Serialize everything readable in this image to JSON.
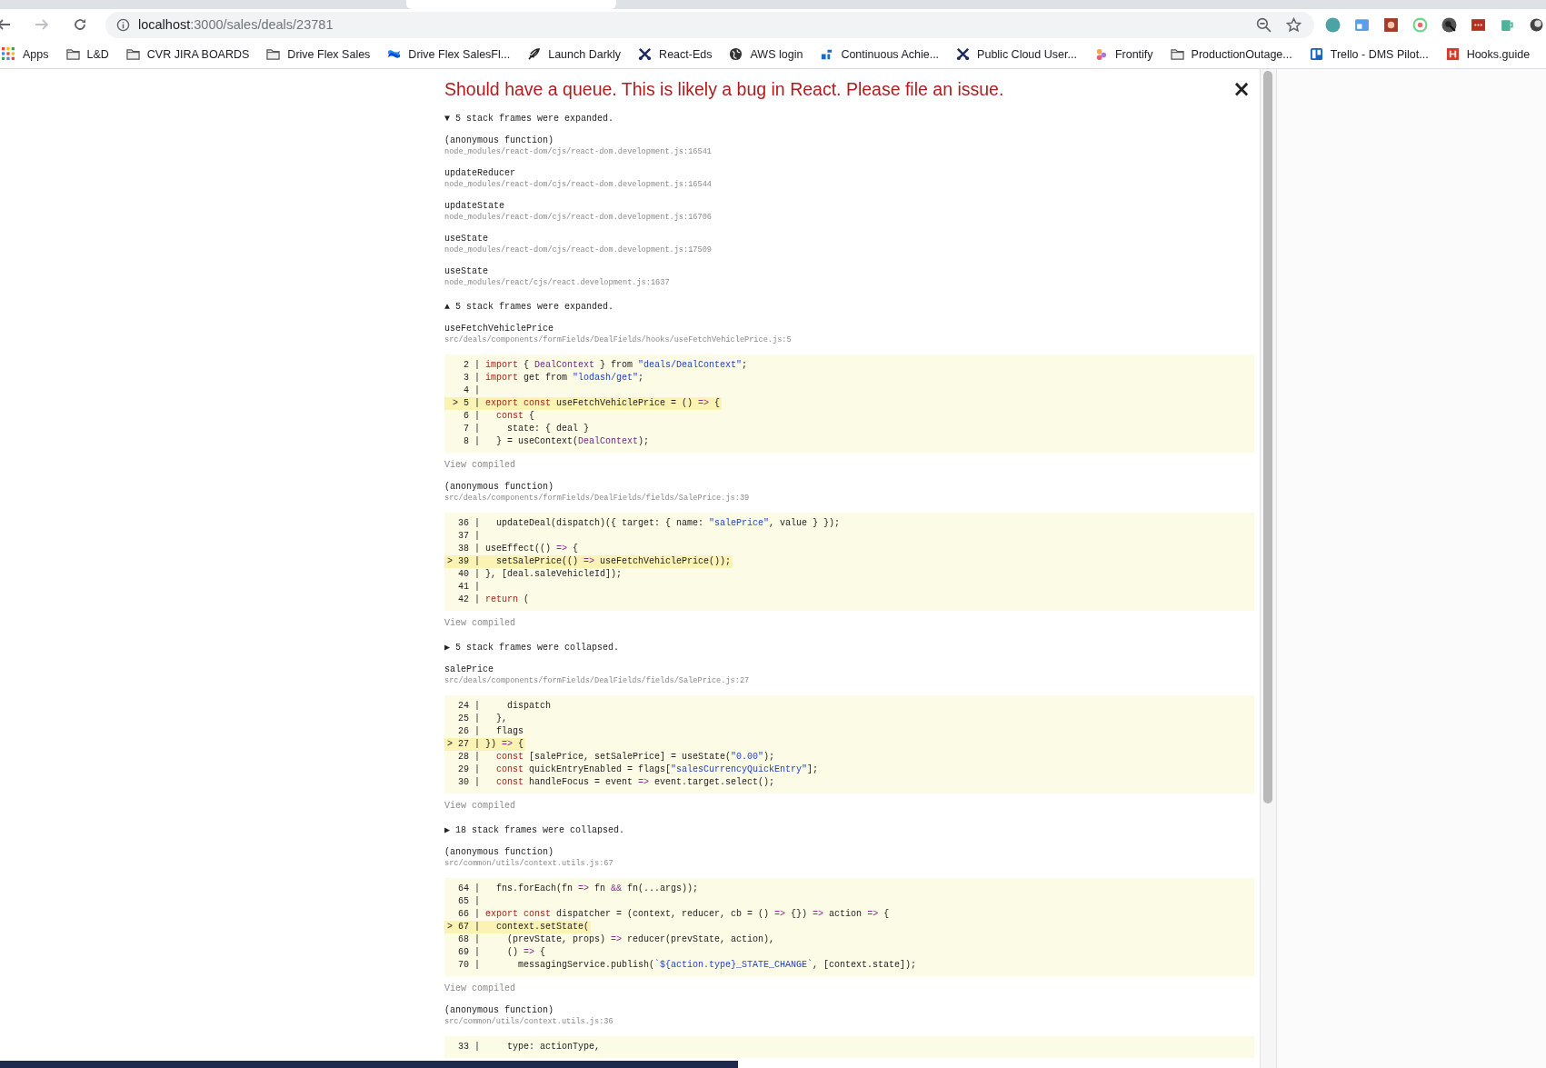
{
  "browser": {
    "url_host": "localhost",
    "url_path": ":3000/sales/deals/23781"
  },
  "bookmarks": [
    {
      "label": "Apps",
      "kind": "apps"
    },
    {
      "label": "L&D",
      "kind": "folder"
    },
    {
      "label": "CVR JIRA BOARDS",
      "kind": "folder"
    },
    {
      "label": "Drive Flex Sales",
      "kind": "folder"
    },
    {
      "label": "Drive Flex SalesFl...",
      "kind": "ribbon"
    },
    {
      "label": "Launch Darkly",
      "kind": "feather"
    },
    {
      "label": "React-Eds",
      "kind": "cross"
    },
    {
      "label": "AWS login",
      "kind": "globe"
    },
    {
      "label": "Continuous Achie...",
      "kind": "logo"
    },
    {
      "label": "Public Cloud User...",
      "kind": "cross"
    },
    {
      "label": "Frontify",
      "kind": "dots"
    },
    {
      "label": "ProductionOutage...",
      "kind": "folder"
    },
    {
      "label": "Trello - DMS Pilot...",
      "kind": "board"
    },
    {
      "label": "Hooks.guide",
      "kind": "square"
    }
  ],
  "error": {
    "title": "Should have a queue. This is likely a bug in React. Please file an issue.",
    "close": "×",
    "sections": [
      {
        "kind": "toggle",
        "text": "▼ 5 stack frames were expanded."
      },
      {
        "kind": "frame",
        "function": "(anonymous function)",
        "location": "node_modules/react-dom/cjs/react-dom.development.js:16541"
      },
      {
        "kind": "frame",
        "function": "updateReducer",
        "location": "node_modules/react-dom/cjs/react-dom.development.js:16544"
      },
      {
        "kind": "frame",
        "function": "updateState",
        "location": "node_modules/react-dom/cjs/react-dom.development.js:16706"
      },
      {
        "kind": "frame",
        "function": "useState",
        "location": "node_modules/react-dom/cjs/react-dom.development.js:17509"
      },
      {
        "kind": "frame",
        "function": "useState",
        "location": "node_modules/react/cjs/react.development.js:1637"
      },
      {
        "kind": "toggle",
        "text": "▲ 5 stack frames were expanded."
      },
      {
        "kind": "frame",
        "function": "useFetchVehiclePrice",
        "location": "src/deals/components/formFields/DealFields/hooks/useFetchVehiclePrice.js:5",
        "link": "View compiled",
        "code": [
          {
            "gutter": "2 |",
            "highlighted": false,
            "segments": [
              {
                "text": "import",
                "kind": "keyword"
              },
              {
                "text": " { ",
                "kind": "plain"
              },
              {
                "text": "DealContext",
                "kind": "name"
              },
              {
                "text": " } from ",
                "kind": "plain"
              },
              {
                "text": "\"deals/DealContext\"",
                "kind": "string"
              },
              {
                "text": ";",
                "kind": "plain"
              }
            ]
          },
          {
            "gutter": "3 |",
            "highlighted": false,
            "segments": [
              {
                "text": "import",
                "kind": "keyword"
              },
              {
                "text": " get from ",
                "kind": "plain"
              },
              {
                "text": "\"lodash/get\"",
                "kind": "string"
              },
              {
                "text": ";",
                "kind": "plain"
              }
            ]
          },
          {
            "gutter": "4 |",
            "highlighted": false
          },
          {
            "gutter": "> 5 |",
            "highlighted": true,
            "segments": [
              {
                "text": "export const",
                "kind": "keyword"
              },
              {
                "text": " useFetchVehiclePrice = () ",
                "kind": "plain"
              },
              {
                "text": "=>",
                "kind": "operator"
              },
              {
                "text": " {",
                "kind": "plain"
              }
            ]
          },
          {
            "gutter": "6 |",
            "highlighted": false,
            "segments": [
              {
                "text": "  const",
                "kind": "keyword"
              },
              {
                "text": " {",
                "kind": "plain"
              }
            ]
          },
          {
            "gutter": "7 |",
            "highlighted": false,
            "segments": [
              {
                "text": "    state: { deal }",
                "kind": "plain"
              }
            ]
          },
          {
            "gutter": "8 |",
            "highlighted": false,
            "segments": [
              {
                "text": "  } = useContext(",
                "kind": "plain"
              },
              {
                "text": "DealContext",
                "kind": "name"
              },
              {
                "text": ");",
                "kind": "plain"
              }
            ]
          }
        ]
      },
      {
        "kind": "frame",
        "function": "(anonymous function)",
        "location": "src/deals/components/formFields/DealFields/fields/SalePrice.js:39",
        "link": "View compiled",
        "code": [
          {
            "gutter": "36 |",
            "highlighted": false,
            "segments": [
              {
                "text": "  updateDeal(dispatch)({ target: { name: ",
                "kind": "plain"
              },
              {
                "text": "\"salePrice\"",
                "kind": "string"
              },
              {
                "text": ", value } });",
                "kind": "plain"
              }
            ]
          },
          {
            "gutter": "37 |",
            "highlighted": false
          },
          {
            "gutter": "38 |",
            "highlighted": false,
            "segments": [
              {
                "text": "useEffect(() ",
                "kind": "plain"
              },
              {
                "text": "=>",
                "kind": "operator"
              },
              {
                "text": " {",
                "kind": "plain"
              }
            ]
          },
          {
            "gutter": "> 39 |",
            "highlighted": true,
            "segments": [
              {
                "text": "  setSalePrice(() ",
                "kind": "plain"
              },
              {
                "text": "=>",
                "kind": "operator"
              },
              {
                "text": " useFetchVehiclePrice());",
                "kind": "plain"
              }
            ]
          },
          {
            "gutter": "40 |",
            "highlighted": false,
            "segments": [
              {
                "text": "}, [deal.saleVehicleId]);",
                "kind": "plain"
              }
            ]
          },
          {
            "gutter": "41 |",
            "highlighted": false
          },
          {
            "gutter": "42 |",
            "highlighted": false,
            "segments": [
              {
                "text": "return",
                "kind": "keyword"
              },
              {
                "text": " (",
                "kind": "plain"
              }
            ]
          }
        ]
      },
      {
        "kind": "toggle",
        "text": "▶ 5 stack frames were collapsed."
      },
      {
        "kind": "frame",
        "function": "salePrice",
        "location": "src/deals/components/formFields/DealFields/fields/SalePrice.js:27",
        "link": "View compiled",
        "code": [
          {
            "gutter": "24 |",
            "highlighted": false,
            "segments": [
              {
                "text": "    dispatch",
                "kind": "plain"
              }
            ]
          },
          {
            "gutter": "25 |",
            "highlighted": false,
            "segments": [
              {
                "text": "  },",
                "kind": "plain"
              }
            ]
          },
          {
            "gutter": "26 |",
            "highlighted": false,
            "segments": [
              {
                "text": "  flags",
                "kind": "plain"
              }
            ]
          },
          {
            "gutter": "> 27 |",
            "highlighted": true,
            "segments": [
              {
                "text": "}) ",
                "kind": "plain"
              },
              {
                "text": "=>",
                "kind": "operator"
              },
              {
                "text": " {",
                "kind": "plain"
              }
            ]
          },
          {
            "gutter": "28 |",
            "highlighted": false,
            "segments": [
              {
                "text": "  const",
                "kind": "keyword"
              },
              {
                "text": " [salePrice, setSalePrice] = useState(",
                "kind": "plain"
              },
              {
                "text": "\"0.00\"",
                "kind": "string"
              },
              {
                "text": ");",
                "kind": "plain"
              }
            ]
          },
          {
            "gutter": "29 |",
            "highlighted": false,
            "segments": [
              {
                "text": "  const",
                "kind": "keyword"
              },
              {
                "text": " quickEntryEnabled = flags[",
                "kind": "plain"
              },
              {
                "text": "\"salesCurrencyQuickEntry\"",
                "kind": "string"
              },
              {
                "text": "];",
                "kind": "plain"
              }
            ]
          },
          {
            "gutter": "30 |",
            "highlighted": false,
            "segments": [
              {
                "text": "  const",
                "kind": "keyword"
              },
              {
                "text": " handleFocus = event ",
                "kind": "plain"
              },
              {
                "text": "=>",
                "kind": "operator"
              },
              {
                "text": " event.target.select();",
                "kind": "plain"
              }
            ]
          }
        ]
      },
      {
        "kind": "toggle",
        "text": "▶ 18 stack frames were collapsed."
      },
      {
        "kind": "frame",
        "function": "(anonymous function)",
        "location": "src/common/utils/context.utils.js:67",
        "link": "View compiled",
        "code": [
          {
            "gutter": "64 |",
            "highlighted": false,
            "segments": [
              {
                "text": "  fns.forEach(fn ",
                "kind": "plain"
              },
              {
                "text": "=>",
                "kind": "operator"
              },
              {
                "text": " fn ",
                "kind": "plain"
              },
              {
                "text": "&&",
                "kind": "operator"
              },
              {
                "text": " fn(...args));",
                "kind": "plain"
              }
            ]
          },
          {
            "gutter": "65 |",
            "highlighted": false
          },
          {
            "gutter": "66 |",
            "highlighted": false,
            "segments": [
              {
                "text": "export const",
                "kind": "keyword"
              },
              {
                "text": " dispatcher = (context, reducer, cb = () ",
                "kind": "plain"
              },
              {
                "text": "=>",
                "kind": "operator"
              },
              {
                "text": " {}) ",
                "kind": "plain"
              },
              {
                "text": "=>",
                "kind": "operator"
              },
              {
                "text": " action ",
                "kind": "plain"
              },
              {
                "text": "=>",
                "kind": "operator"
              },
              {
                "text": " {",
                "kind": "plain"
              }
            ]
          },
          {
            "gutter": "> 67 |",
            "highlighted": true,
            "segments": [
              {
                "text": "  context.setState(",
                "kind": "plain"
              }
            ]
          },
          {
            "gutter": "68 |",
            "highlighted": false,
            "segments": [
              {
                "text": "    (prevState, props) ",
                "kind": "plain"
              },
              {
                "text": "=>",
                "kind": "operator"
              },
              {
                "text": " reducer(prevState, action),",
                "kind": "plain"
              }
            ]
          },
          {
            "gutter": "69 |",
            "highlighted": false,
            "segments": [
              {
                "text": "    () ",
                "kind": "plain"
              },
              {
                "text": "=>",
                "kind": "operator"
              },
              {
                "text": " {",
                "kind": "plain"
              }
            ]
          },
          {
            "gutter": "70 |",
            "highlighted": false,
            "segments": [
              {
                "text": "      messagingService.publish(",
                "kind": "plain"
              },
              {
                "text": "`${action.type}_STATE_CHANGE`",
                "kind": "string"
              },
              {
                "text": ", [context.state]);",
                "kind": "plain"
              }
            ]
          }
        ]
      },
      {
        "kind": "frame",
        "function": "(anonymous function)",
        "location": "src/common/utils/context.utils.js:36",
        "code": [
          {
            "gutter": "33 |",
            "highlighted": false,
            "segments": [
              {
                "text": "    type: actionType,",
                "kind": "plain"
              }
            ]
          }
        ]
      }
    ]
  }
}
